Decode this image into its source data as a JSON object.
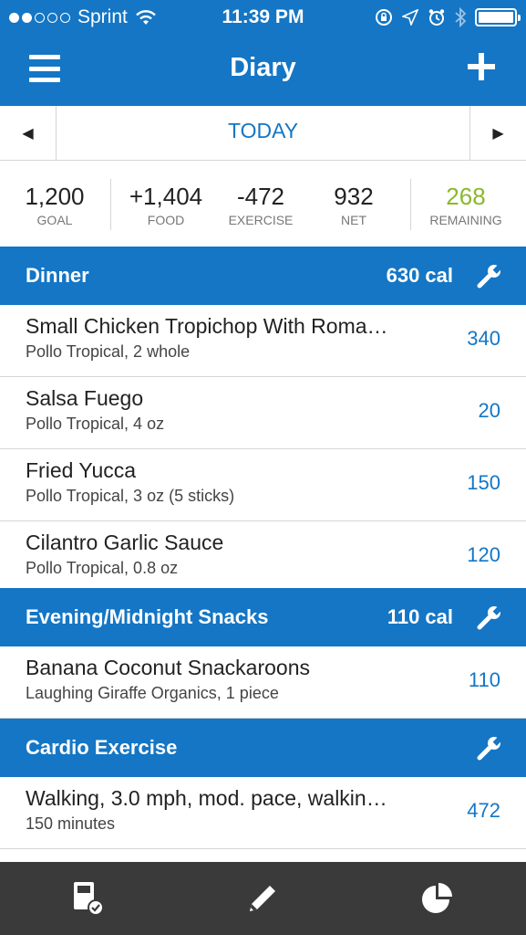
{
  "status_bar": {
    "carrier": "Sprint",
    "time": "11:39 PM"
  },
  "header": {
    "title": "Diary"
  },
  "date_nav": {
    "label": "TODAY",
    "prev_glyph": "◀",
    "next_glyph": "▶"
  },
  "summary": {
    "goal": {
      "value": "1,200",
      "label": "GOAL"
    },
    "food": {
      "value": "+1,404",
      "label": "FOOD"
    },
    "exercise": {
      "value": "-472",
      "label": "EXERCISE"
    },
    "net": {
      "value": "932",
      "label": "NET"
    },
    "remaining": {
      "value": "268",
      "label": "REMAINING"
    }
  },
  "sections": {
    "dinner": {
      "name": "Dinner",
      "calories": "630 cal",
      "entries": [
        {
          "name": "Small Chicken Tropichop With Roma…",
          "detail": "Pollo Tropical, 2 whole",
          "calories": "340"
        },
        {
          "name": "Salsa Fuego",
          "detail": "Pollo Tropical, 4 oz",
          "calories": "20"
        },
        {
          "name": "Fried Yucca",
          "detail": "Pollo Tropical, 3 oz (5 sticks)",
          "calories": "150"
        },
        {
          "name": "Cilantro Garlic Sauce",
          "detail": "Pollo Tropical, 0.8 oz",
          "calories": "120"
        }
      ]
    },
    "snacks": {
      "name": "Evening/Midnight Snacks",
      "calories": "110 cal",
      "entries": [
        {
          "name": "Banana Coconut Snackaroons",
          "detail": "Laughing Giraffe Organics, 1 piece",
          "calories": "110"
        }
      ]
    },
    "cardio": {
      "name": "Cardio Exercise",
      "entries": [
        {
          "name": "Walking, 3.0 mph, mod. pace, walkin…",
          "detail": "150 minutes",
          "calories": "472"
        }
      ]
    }
  },
  "icons": {
    "menu": "hamburger-menu-icon",
    "add": "plus-icon",
    "wrench": "wrench-icon",
    "diary_tab": "diary-check-icon",
    "edit_tab": "pencil-icon",
    "reports_tab": "pie-chart-icon"
  },
  "colors": {
    "brand_blue": "#1476c5",
    "remaining_green": "#8ab82b",
    "tab_bar": "#3a3a3a"
  }
}
